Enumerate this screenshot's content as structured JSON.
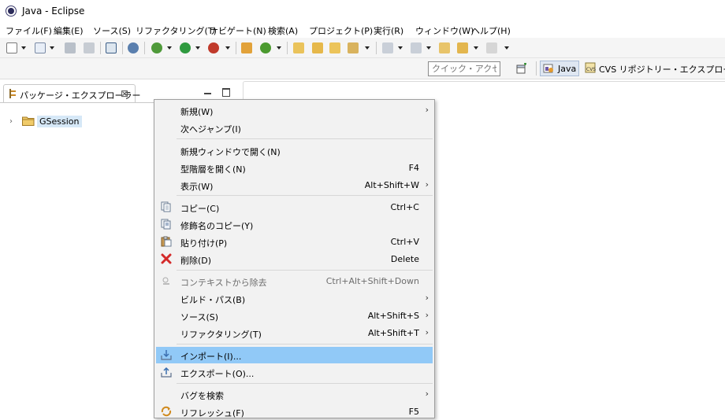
{
  "window": {
    "title": "Java - Eclipse"
  },
  "menubar": [
    "ファイル(F)",
    "編集(E)",
    "ソース(S)",
    "リファクタリング(T)",
    "ナビゲート(N)",
    "検索(A)",
    "プロジェクト(P)",
    "実行(R)",
    "ウィンドウ(W)",
    "ヘルプ(H)"
  ],
  "toolbar": {
    "quick_access_placeholder": "クイック・アクセス",
    "perspectives": {
      "java": "Java",
      "cvs": "CVS リポジトリー・エクスプローラー"
    }
  },
  "package_explorer": {
    "tab_label": "パッケージ・エクスプローラー",
    "close_glyph": "⊠",
    "tree": [
      {
        "label": "GSession",
        "toggle": "›"
      }
    ]
  },
  "context_menu": {
    "submenu_arrow": "›",
    "items": [
      {
        "label": "新規(W)",
        "accel": "",
        "submenu": true
      },
      {
        "label": "次へジャンプ(I)",
        "accel": "",
        "submenu": false
      },
      {
        "label": "新規ウィンドウで開く(N)",
        "accel": "",
        "submenu": false
      },
      {
        "label": "型階層を開く(N)",
        "accel": "F4",
        "submenu": false
      },
      {
        "label": "表示(W)",
        "accel": "Alt+Shift+W",
        "submenu": true
      },
      {
        "label": "コピー(C)",
        "accel": "Ctrl+C",
        "submenu": false,
        "icon": "copy-icon"
      },
      {
        "label": "修飾名のコピー(Y)",
        "accel": "",
        "submenu": false,
        "icon": "copy-qualified-icon"
      },
      {
        "label": "貼り付け(P)",
        "accel": "Ctrl+V",
        "submenu": false,
        "icon": "paste-icon"
      },
      {
        "label": "削除(D)",
        "accel": "Delete",
        "submenu": false,
        "icon": "delete-icon"
      },
      {
        "label": "コンテキストから除去",
        "accel": "Ctrl+Alt+Shift+Down",
        "submenu": false,
        "disabled": true,
        "icon": "remove-context-icon"
      },
      {
        "label": "ビルド・パス(B)",
        "accel": "",
        "submenu": true
      },
      {
        "label": "ソース(S)",
        "accel": "Alt+Shift+S",
        "submenu": true
      },
      {
        "label": "リファクタリング(T)",
        "accel": "Alt+Shift+T",
        "submenu": true
      },
      {
        "label": "インポート(I)...",
        "accel": "",
        "submenu": false,
        "highlighted": true,
        "icon": "import-icon"
      },
      {
        "label": "エクスポート(O)...",
        "accel": "",
        "submenu": false,
        "icon": "export-icon"
      },
      {
        "label": "バグを検索",
        "accel": "",
        "submenu": true
      },
      {
        "label": "リフレッシュ(F)",
        "accel": "F5",
        "submenu": false,
        "icon": "refresh-icon"
      }
    ]
  },
  "colors": {
    "menu_background": "#f2f2f2",
    "highlight": "#91c9f7",
    "selection": "#d6e8f7",
    "toolbar_background": "#f5f5f5"
  }
}
